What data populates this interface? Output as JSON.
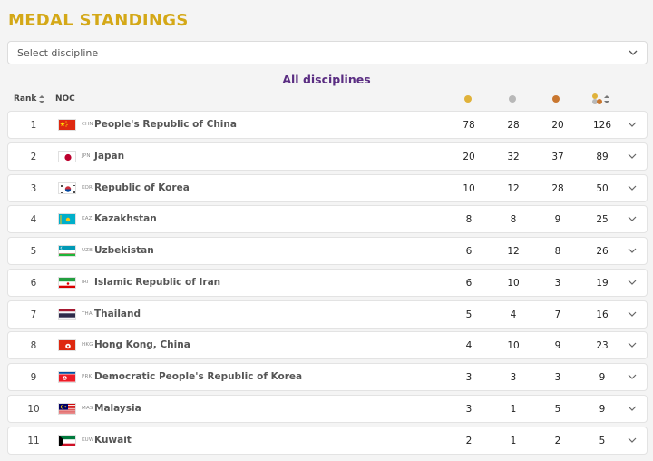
{
  "page": {
    "title": "MEDAL STANDINGS",
    "subtitle": "All disciplines"
  },
  "filter": {
    "placeholder": "Select discipline",
    "icon": "chevron-down-icon"
  },
  "table": {
    "headers": {
      "rank": "Rank",
      "noc": "NOC"
    },
    "medal_colors": {
      "gold": "#e0b23a",
      "silver": "#b8b8b8",
      "bronze": "#c9772f"
    },
    "rows": [
      {
        "rank": "1",
        "code": "CHN",
        "name": "People's Republic of China",
        "gold": "78",
        "silver": "28",
        "bronze": "20",
        "total": "126"
      },
      {
        "rank": "2",
        "code": "JPN",
        "name": "Japan",
        "gold": "20",
        "silver": "32",
        "bronze": "37",
        "total": "89"
      },
      {
        "rank": "3",
        "code": "KOR",
        "name": "Republic of Korea",
        "gold": "10",
        "silver": "12",
        "bronze": "28",
        "total": "50"
      },
      {
        "rank": "4",
        "code": "KAZ",
        "name": "Kazakhstan",
        "gold": "8",
        "silver": "8",
        "bronze": "9",
        "total": "25"
      },
      {
        "rank": "5",
        "code": "UZB",
        "name": "Uzbekistan",
        "gold": "6",
        "silver": "12",
        "bronze": "8",
        "total": "26"
      },
      {
        "rank": "6",
        "code": "IRI",
        "name": "Islamic Republic of Iran",
        "gold": "6",
        "silver": "10",
        "bronze": "3",
        "total": "19"
      },
      {
        "rank": "7",
        "code": "THA",
        "name": "Thailand",
        "gold": "5",
        "silver": "4",
        "bronze": "7",
        "total": "16"
      },
      {
        "rank": "8",
        "code": "HKG",
        "name": "Hong Kong, China",
        "gold": "4",
        "silver": "10",
        "bronze": "9",
        "total": "23"
      },
      {
        "rank": "9",
        "code": "PRK",
        "name": "Democratic People's Republic of Korea",
        "gold": "3",
        "silver": "3",
        "bronze": "3",
        "total": "9"
      },
      {
        "rank": "10",
        "code": "MAS",
        "name": "Malaysia",
        "gold": "3",
        "silver": "1",
        "bronze": "5",
        "total": "9"
      },
      {
        "rank": "11",
        "code": "KUW",
        "name": "Kuwait",
        "gold": "2",
        "silver": "1",
        "bronze": "2",
        "total": "5"
      }
    ]
  }
}
